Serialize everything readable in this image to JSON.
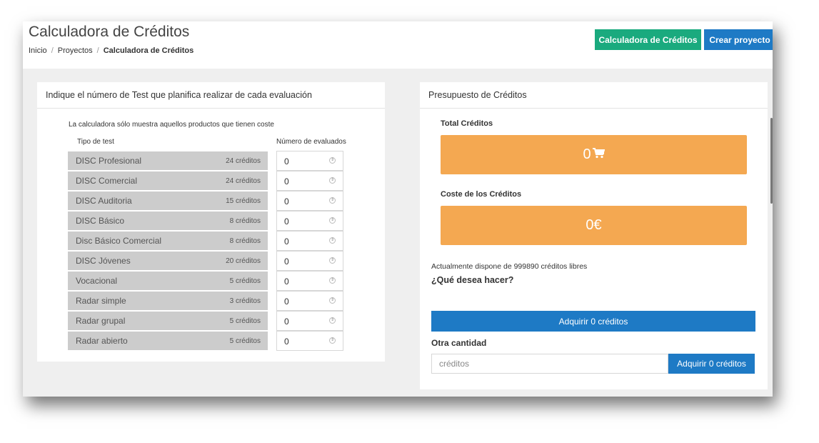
{
  "header": {
    "title": "Calculadora de Créditos",
    "breadcrumb": [
      {
        "label": "Inicio"
      },
      {
        "label": "Proyectos"
      },
      {
        "label": "Calculadora de Créditos"
      }
    ],
    "buttons": {
      "calculator": "Calculadora de Créditos",
      "create_project": "Crear proyecto"
    }
  },
  "calculator": {
    "heading": "Indique el número de Test que planifica realizar de cada evaluación",
    "notice": "La calculadora sólo muestra aquellos productos que tienen coste",
    "col_test_type": "Tipo de test",
    "col_evaluated": "Número de evaluados",
    "rows": [
      {
        "name": "DISC Profesional",
        "credits": "24 créditos",
        "value": "0"
      },
      {
        "name": "DISC Comercial",
        "credits": "24 créditos",
        "value": "0"
      },
      {
        "name": "DISC Auditoria",
        "credits": "15 créditos",
        "value": "0"
      },
      {
        "name": "DISC Básico",
        "credits": "8 créditos",
        "value": "0"
      },
      {
        "name": "Disc Básico Comercial",
        "credits": "8 créditos",
        "value": "0"
      },
      {
        "name": "DISC Jóvenes",
        "credits": "20 créditos",
        "value": "0"
      },
      {
        "name": "Vocacional",
        "credits": "5 créditos",
        "value": "0"
      },
      {
        "name": "Radar simple",
        "credits": "3 créditos",
        "value": "0"
      },
      {
        "name": "Radar grupal",
        "credits": "5 créditos",
        "value": "0"
      },
      {
        "name": "Radar abierto",
        "credits": "5 créditos",
        "value": "0"
      }
    ]
  },
  "budget": {
    "heading": "Presupuesto de Créditos",
    "total_label": "Total Créditos",
    "total_value": "0",
    "total_icon": "cart-icon",
    "cost_label": "Coste de los Créditos",
    "cost_value": "0€",
    "available": "Actualmente dispone de 999890 créditos libres",
    "question": "¿Qué desea hacer?",
    "buy_button": "Adquirir 0 créditos",
    "other_label": "Otra cantidad",
    "other_placeholder": "créditos",
    "other_buy_button": "Adquirir 0 créditos"
  },
  "colors": {
    "green": "#1aaa7e",
    "blue": "#1e7ac5",
    "orange": "#f4a851",
    "row_bg": "#cccccc"
  }
}
